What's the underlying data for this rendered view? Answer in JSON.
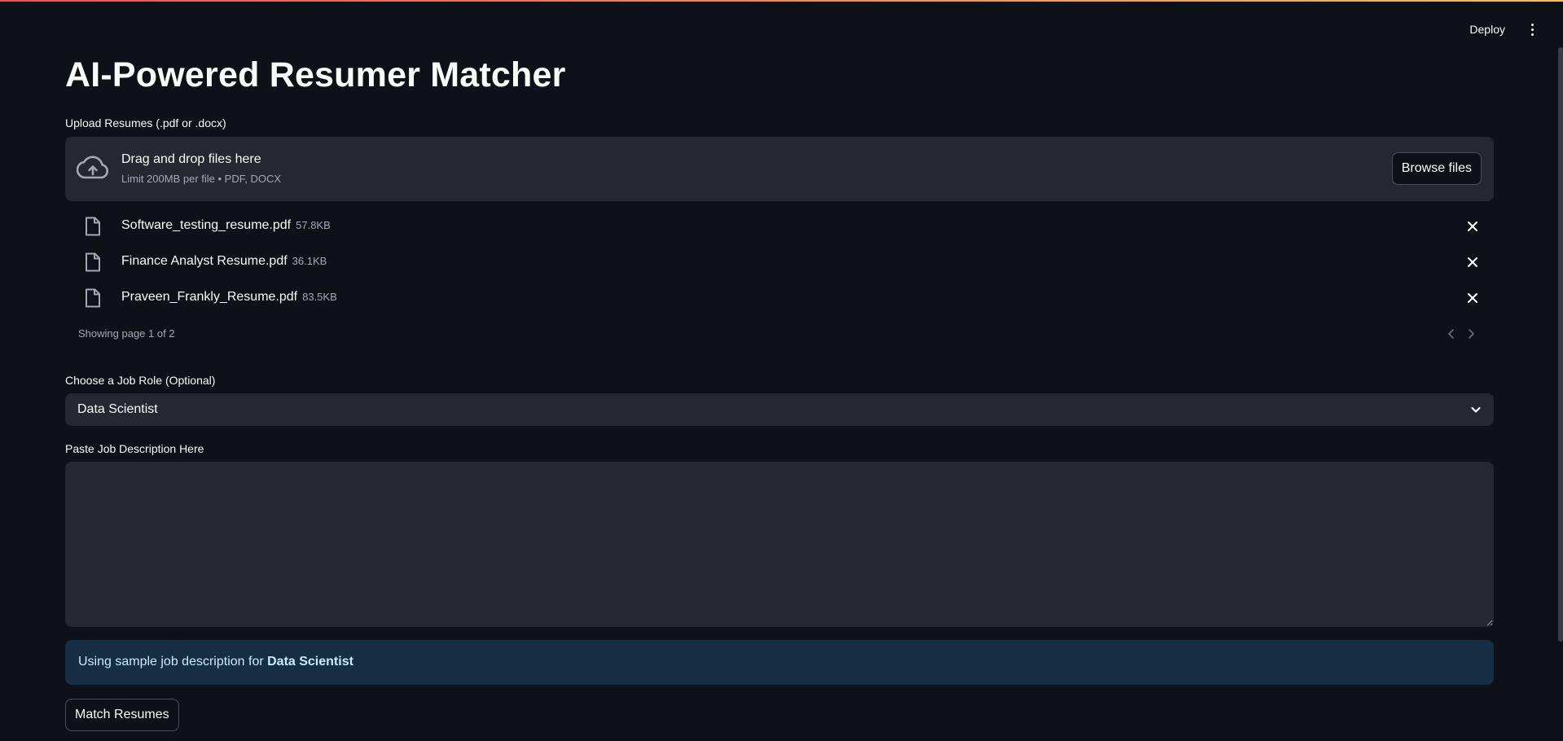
{
  "header": {
    "deploy_label": "Deploy",
    "menu_icon": "kebab-menu-icon"
  },
  "main": {
    "title": "AI-Powered Resumer Matcher",
    "uploader": {
      "label": "Upload Resumes (.pdf or .docx)",
      "drop_title": "Drag and drop files here",
      "drop_limit": "Limit 200MB per file • PDF, DOCX",
      "browse_label": "Browse files",
      "icon": "cloud-upload-icon"
    },
    "files": [
      {
        "name": "Software_testing_resume.pdf",
        "size": "57.8KB"
      },
      {
        "name": "Finance Analyst Resume.pdf",
        "size": "36.1KB"
      },
      {
        "name": "Praveen_Frankly_Resume.pdf",
        "size": "83.5KB"
      }
    ],
    "pagination": {
      "text": "Showing page 1 of 2",
      "current": 1,
      "total": 2
    },
    "job_role": {
      "label": "Choose a Job Role (Optional)",
      "selected": "Data Scientist"
    },
    "job_description": {
      "label": "Paste Job Description Here",
      "value": ""
    },
    "info": {
      "prefix": "Using sample job description for ",
      "role": "Data Scientist"
    },
    "match_button_label": "Match Resumes"
  },
  "colors": {
    "background": "#0e1117",
    "widget": "#262730",
    "info_background": "#172d43",
    "info_text": "#c7ebff",
    "muted_text": "#a3a8b8"
  }
}
